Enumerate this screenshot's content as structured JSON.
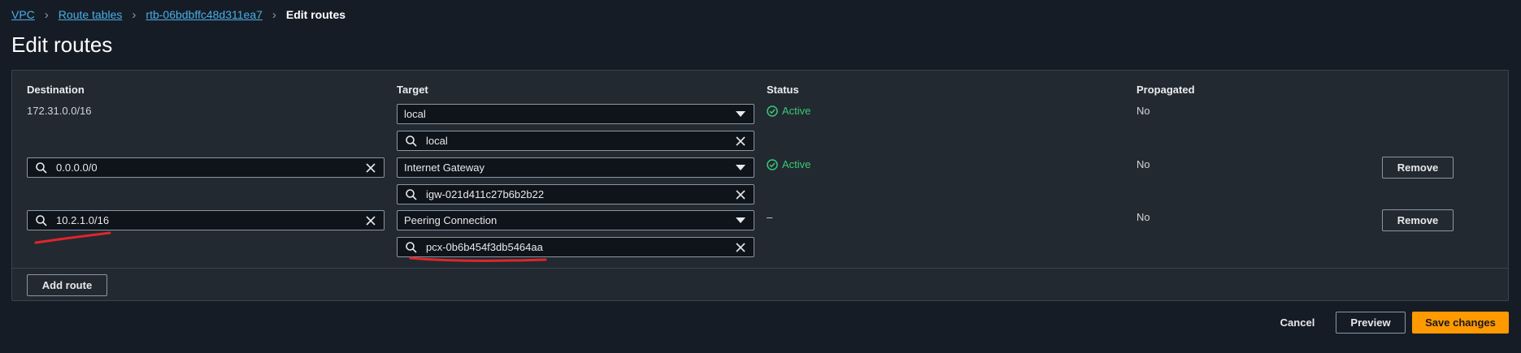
{
  "breadcrumb": {
    "items": [
      "VPC",
      "Route tables",
      "rtb-06bdbffc48d311ea7"
    ],
    "current": "Edit routes"
  },
  "page_title": "Edit routes",
  "table": {
    "columns": {
      "destination": "Destination",
      "target": "Target",
      "status": "Status",
      "propagated": "Propagated"
    },
    "rows": [
      {
        "destination": "172.31.0.0/16",
        "target_type": "local",
        "target_value": "local",
        "status": "Active",
        "propagated": "No"
      },
      {
        "destination": "0.0.0.0/0",
        "target_type": "Internet Gateway",
        "target_value": "igw-021d411c27b6b2b22",
        "status": "Active",
        "propagated": "No",
        "remove_label": "Remove"
      },
      {
        "destination": "10.2.1.0/16",
        "target_type": "Peering Connection",
        "target_value": "pcx-0b6b454f3db5464aa",
        "status": "–",
        "propagated": "No",
        "remove_label": "Remove"
      }
    ]
  },
  "add_route_label": "Add route",
  "actions": {
    "cancel": "Cancel",
    "preview": "Preview",
    "save": "Save changes"
  },
  "colors": {
    "accent": "#ff9900",
    "link": "#4aaee6",
    "success": "#37c978",
    "annotation": "#e0262b"
  },
  "icons": [
    "search-icon",
    "clear-icon",
    "dropdown-caret-icon",
    "status-success-icon",
    "chevron-right-icon"
  ]
}
